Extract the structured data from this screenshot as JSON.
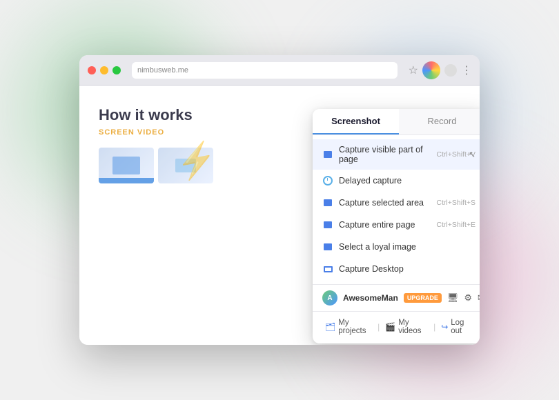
{
  "background": {
    "blob_green": "green ambient light",
    "blob_pink": "pink ambient light",
    "blob_blue": "blue ambient light"
  },
  "browser": {
    "address": "nimbusweb.me",
    "dots": [
      "red",
      "yellow",
      "green"
    ]
  },
  "page": {
    "title": "How it works",
    "subtitle": "SCREEN VIDEO"
  },
  "popup": {
    "tabs": [
      {
        "id": "screenshot",
        "label": "Screenshot",
        "active": true
      },
      {
        "id": "record",
        "label": "Record",
        "active": false
      }
    ],
    "menu_items": [
      {
        "id": "capture-visible",
        "label": "Capture visible part of page",
        "shortcut": "Ctrl+Shift+V",
        "icon": "square",
        "highlighted": true
      },
      {
        "id": "delayed-capture",
        "label": "Delayed capture",
        "shortcut": "",
        "icon": "clock",
        "highlighted": false
      },
      {
        "id": "capture-selected",
        "label": "Capture selected area",
        "shortcut": "Ctrl+Shift+S",
        "icon": "square",
        "highlighted": false
      },
      {
        "id": "capture-entire",
        "label": "Capture entire page",
        "shortcut": "Ctrl+Shift+E",
        "icon": "square",
        "highlighted": false
      },
      {
        "id": "select-loyal",
        "label": "Select a loyal image",
        "shortcut": "",
        "icon": "square",
        "highlighted": false
      },
      {
        "id": "capture-desktop",
        "label": "Capture Desktop",
        "shortcut": "",
        "icon": "monitor",
        "highlighted": false
      }
    ],
    "user": {
      "name": "AwesomeMan",
      "badge": "upgrade",
      "avatar_text": "A"
    },
    "bottom_links": [
      {
        "id": "my-projects",
        "label": "My projects",
        "icon": "🗂"
      },
      {
        "id": "my-videos",
        "label": "My videos",
        "icon": "🎬"
      },
      {
        "id": "log-out",
        "label": "Log out",
        "icon": "↪"
      }
    ],
    "user_icons": [
      "🖥",
      "⚙",
      "✉",
      "⌃"
    ]
  }
}
